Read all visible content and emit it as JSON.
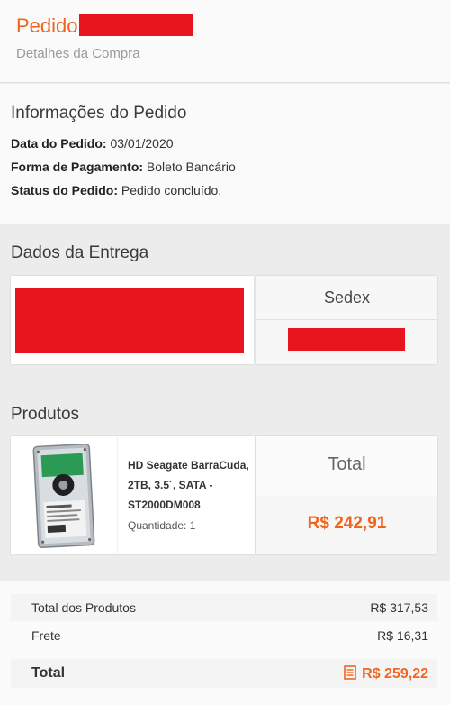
{
  "header": {
    "title": "Pedido",
    "subtitle": "Detalhes da Compra"
  },
  "order_info": {
    "title": "Informações do Pedido",
    "rows": [
      {
        "label": "Data do Pedido:",
        "value": "03/01/2020"
      },
      {
        "label": "Forma de Pagamento:",
        "value": "Boleto Bancário"
      },
      {
        "label": "Status do Pedido:",
        "value": "Pedido concluído."
      }
    ]
  },
  "delivery": {
    "title": "Dados da Entrega",
    "shipping_method": "Sedex"
  },
  "products": {
    "title": "Produtos",
    "items": [
      {
        "name_lines": [
          "HD Seagate BarraCuda,",
          "2TB, 3.5´, SATA -",
          "ST2000DM008"
        ],
        "quantity": "Quantidade: 1",
        "total_label": "Total",
        "total_value": "R$  242,91"
      }
    ]
  },
  "summary": {
    "rows": [
      {
        "label": "Total dos Produtos",
        "value": "R$  317,53"
      },
      {
        "label": "Frete",
        "value": "R$  16,31"
      }
    ],
    "total": {
      "label": "Total",
      "value": "R$  259,22"
    }
  },
  "colors": {
    "accent": "#f1641e",
    "redaction": "#e8151f"
  }
}
